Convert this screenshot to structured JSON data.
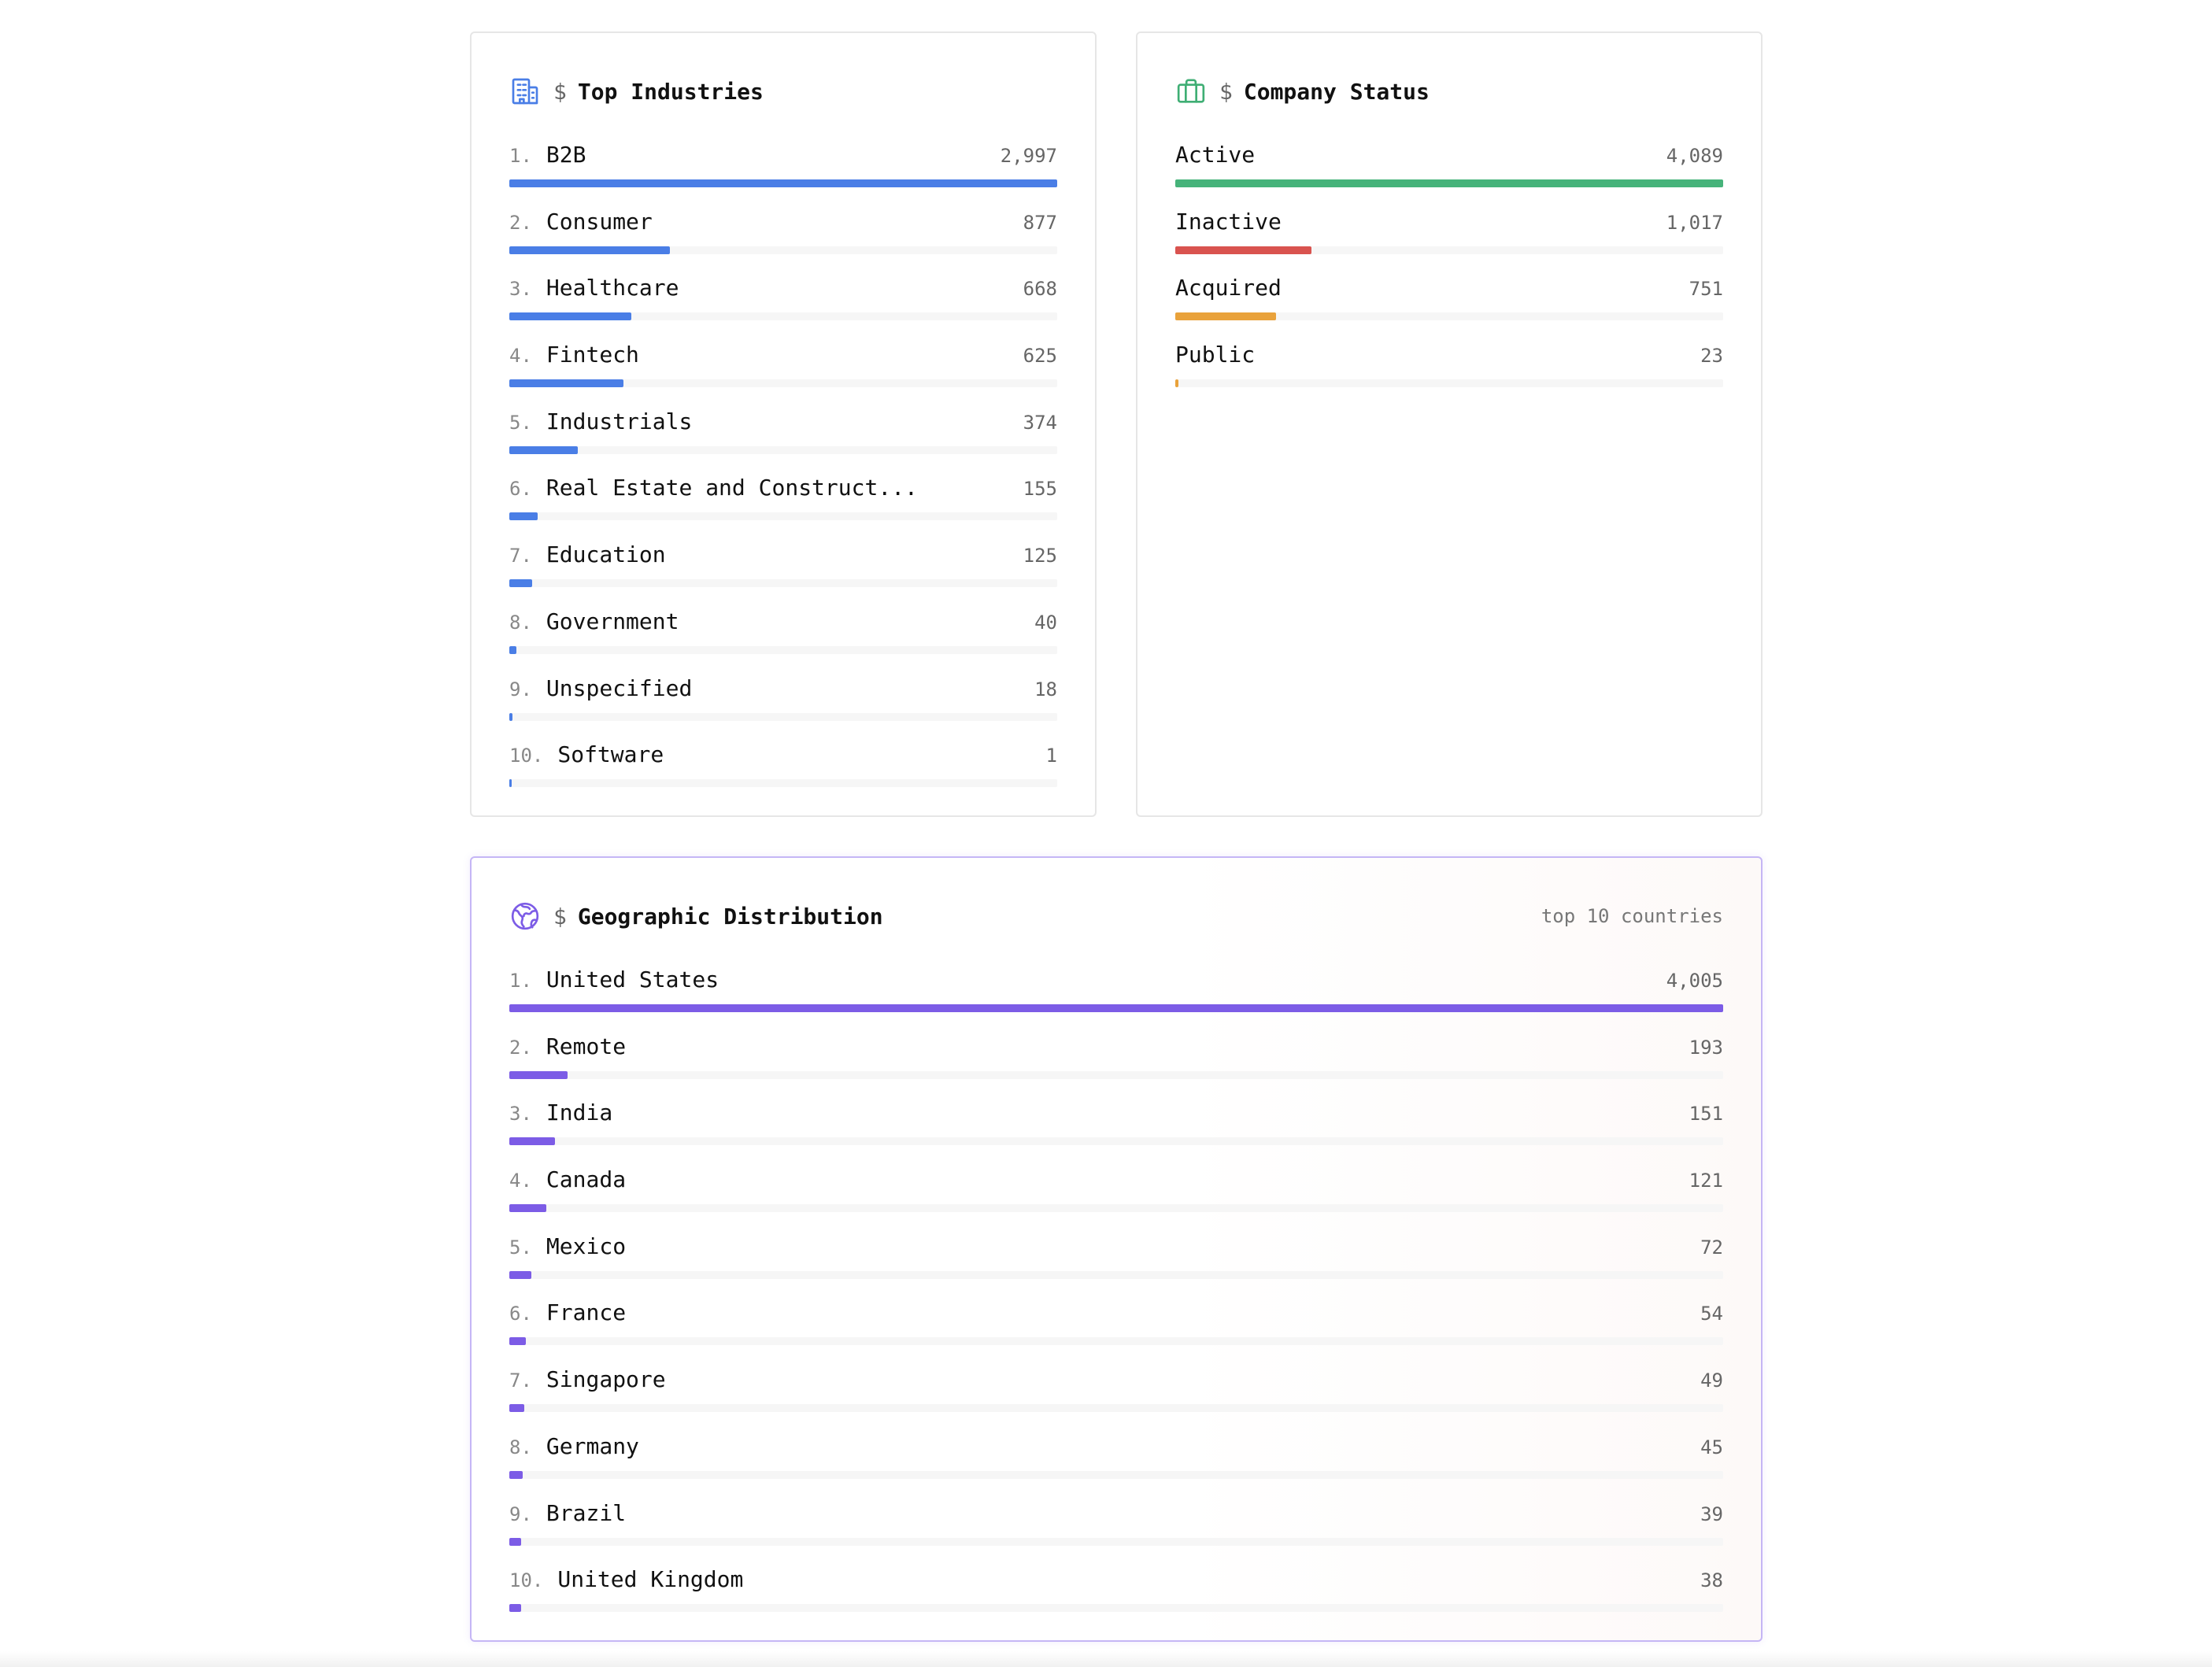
{
  "industries": {
    "prompt": "$",
    "title": "Top Industries",
    "icon": "building-icon",
    "color": "#4a7ee6",
    "items": [
      {
        "rank": "1.",
        "label": "B2B",
        "value": "2,997",
        "count": 2997
      },
      {
        "rank": "2.",
        "label": "Consumer",
        "value": "877",
        "count": 877
      },
      {
        "rank": "3.",
        "label": "Healthcare",
        "value": "668",
        "count": 668
      },
      {
        "rank": "4.",
        "label": "Fintech",
        "value": "625",
        "count": 625
      },
      {
        "rank": "5.",
        "label": "Industrials",
        "value": "374",
        "count": 374
      },
      {
        "rank": "6.",
        "label": "Real Estate and Construct...",
        "value": "155",
        "count": 155
      },
      {
        "rank": "7.",
        "label": "Education",
        "value": "125",
        "count": 125
      },
      {
        "rank": "8.",
        "label": "Government",
        "value": "40",
        "count": 40
      },
      {
        "rank": "9.",
        "label": "Unspecified",
        "value": "18",
        "count": 18
      },
      {
        "rank": "10.",
        "label": "Software",
        "value": "1",
        "count": 1
      }
    ]
  },
  "status": {
    "prompt": "$",
    "title": "Company Status",
    "icon": "briefcase-icon",
    "color": "#3fae74",
    "items": [
      {
        "label": "Active",
        "value": "4,089",
        "count": 4089,
        "color": "#46b37a"
      },
      {
        "label": "Inactive",
        "value": "1,017",
        "count": 1017,
        "color": "#d9534f"
      },
      {
        "label": "Acquired",
        "value": "751",
        "count": 751,
        "color": "#e9a23b"
      },
      {
        "label": "Public",
        "value": "23",
        "count": 23,
        "color": "#e9a23b"
      }
    ]
  },
  "geo": {
    "prompt": "$",
    "title": "Geographic Distribution",
    "subtitle": "top 10 countries",
    "icon": "globe-icon",
    "color": "#7c5ce6",
    "items": [
      {
        "rank": "1.",
        "label": "United States",
        "value": "4,005",
        "count": 4005
      },
      {
        "rank": "2.",
        "label": "Remote",
        "value": "193",
        "count": 193
      },
      {
        "rank": "3.",
        "label": "India",
        "value": "151",
        "count": 151
      },
      {
        "rank": "4.",
        "label": "Canada",
        "value": "121",
        "count": 121
      },
      {
        "rank": "5.",
        "label": "Mexico",
        "value": "72",
        "count": 72
      },
      {
        "rank": "6.",
        "label": "France",
        "value": "54",
        "count": 54
      },
      {
        "rank": "7.",
        "label": "Singapore",
        "value": "49",
        "count": 49
      },
      {
        "rank": "8.",
        "label": "Germany",
        "value": "45",
        "count": 45
      },
      {
        "rank": "9.",
        "label": "Brazil",
        "value": "39",
        "count": 39
      },
      {
        "rank": "10.",
        "label": "United Kingdom",
        "value": "38",
        "count": 38
      }
    ]
  }
}
